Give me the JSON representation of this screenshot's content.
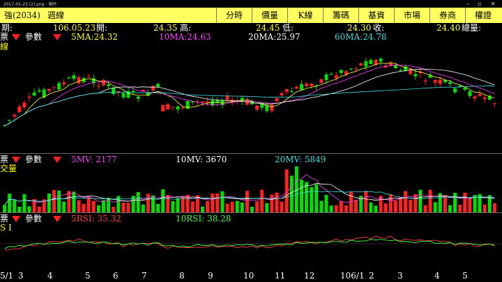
{
  "window": {
    "title": "2017-05-23 (2).png - 相片"
  },
  "header": {
    "stock_name": "強(2034)",
    "chart_name": "週線",
    "tabs": [
      "分時",
      "價量",
      "K線",
      "籌碼",
      "基資",
      "市場",
      "券商",
      "權證"
    ]
  },
  "info_row": {
    "date_label": "期:",
    "date": "106.05.23",
    "open_label": "開:",
    "open": "24.35",
    "high_label": "高:",
    "high": "24.45",
    "low_label": "低:",
    "low": "24.30",
    "close_label": "收:",
    "close": "24.40",
    "vol_label": "總量:"
  },
  "ma_row": {
    "params": "參數",
    "ma5": "5MA:24.32",
    "ma10": "10MA:24.63",
    "ma20": "20MA:25.97",
    "ma60": "60MA:24.78"
  },
  "price_panel": {
    "label": "線"
  },
  "volume_row": {
    "params": "參數",
    "mv5": "5MV: 2177",
    "mv10": "10MV: 3670",
    "mv20": "20MV: 5849"
  },
  "volume_panel": {
    "label": "交量"
  },
  "rsi_row": {
    "params": "參數",
    "rsi5": "5RSI: 35.32",
    "rsi10": "10RSI: 38.28"
  },
  "rsi_panel": {
    "label": "S I"
  },
  "x_axis": {
    "labels": [
      "5/1",
      "3",
      "4",
      "5",
      "6",
      "7",
      "8",
      "9",
      "10",
      "11",
      "12",
      "106/1",
      "2",
      "3",
      "4",
      "5"
    ]
  },
  "colors": {
    "up": "#ff2020",
    "down": "#00e000",
    "header": "#ffff5f"
  }
}
